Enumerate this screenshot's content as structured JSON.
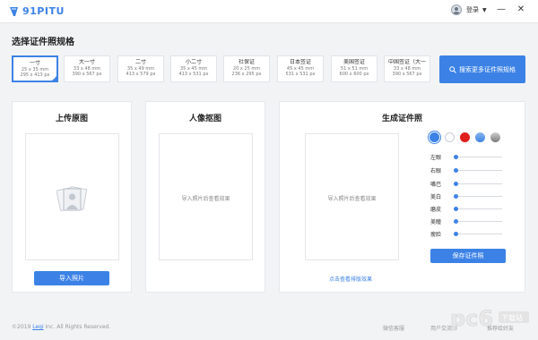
{
  "app": {
    "logo_text": "91PITU"
  },
  "titlebar": {
    "login_label": "登录",
    "caret": "▼",
    "minimize": "—",
    "close": "✕"
  },
  "section_title": "选择证件照规格",
  "sizes": [
    {
      "name": "一寸",
      "mm": "25 x 35 mm",
      "px": "295 x 413 px",
      "selected": true
    },
    {
      "name": "大一寸",
      "mm": "33 x 48 mm",
      "px": "390 x 567 px"
    },
    {
      "name": "二寸",
      "mm": "35 x 49 mm",
      "px": "413 x 579 px"
    },
    {
      "name": "小二寸",
      "mm": "35 x 45 mm",
      "px": "413 x 531 px"
    },
    {
      "name": "社保证",
      "mm": "20 x 25 mm",
      "px": "236 x 295 px"
    },
    {
      "name": "日本签证",
      "mm": "45 x 45 mm",
      "px": "531 x 531 px"
    },
    {
      "name": "美国签证",
      "mm": "51 x 51 mm",
      "px": "600 x 600 px"
    },
    {
      "name": "中国签证（大一",
      "mm": "33 x 48 mm",
      "px": "390 x 567 px"
    }
  ],
  "search_more": "搜索更多证件照规格",
  "panels": {
    "upload": {
      "title": "上传原图",
      "button": "导入照片"
    },
    "cutout": {
      "title": "人像抠图",
      "placeholder": "导入照片后查看效果"
    },
    "result": {
      "title": "生成证件照",
      "placeholder": "导入照片后查看效果",
      "link": "点击查看排版效果",
      "save": "保存证件照"
    }
  },
  "background_colors": [
    "#3c82e6",
    "#ffffff",
    "#e01e1e",
    "#5f9be6",
    "#9a9a9a"
  ],
  "sliders": [
    "左眼",
    "右眼",
    "嘴巴",
    "美白",
    "磨皮",
    "美瞳",
    "瘦脸"
  ],
  "slider_values": [
    0,
    0,
    0,
    0,
    0,
    0,
    0
  ],
  "footer": {
    "copyright_prefix": "©2019",
    "company_link": "Leqi",
    "copyright_suffix": "Inc. All Rights Reserved.",
    "wechat": "微信客服",
    "qq": "用户交流群",
    "recommend": "推荐给好友"
  },
  "watermark": {
    "logo": "pc6",
    "caption": "下载站"
  }
}
